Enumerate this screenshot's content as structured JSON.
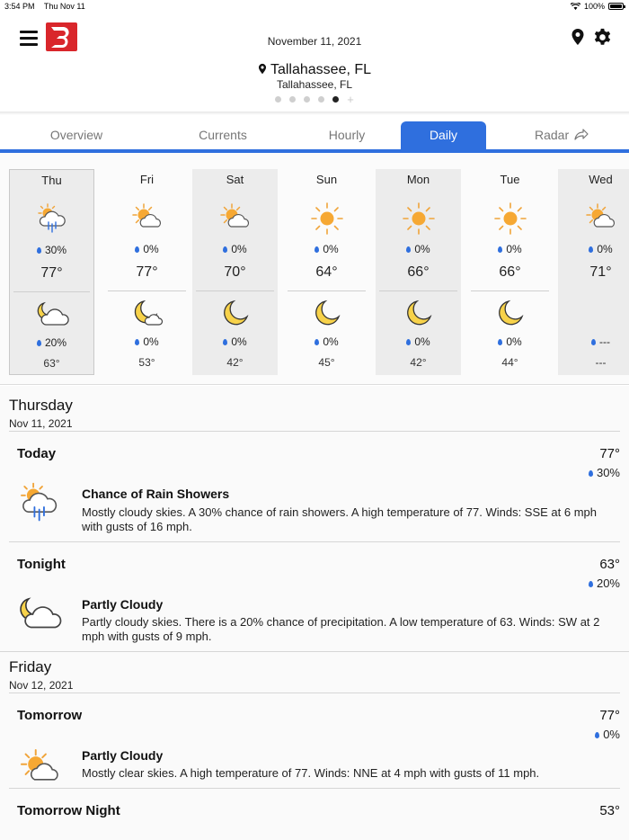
{
  "status_bar": {
    "time": "3:54 PM",
    "date": "Thu Nov 11",
    "battery": "100%",
    "battery_level": 1.0
  },
  "header": {
    "date": "November 11, 2021",
    "location_title": "Tallahassee, FL",
    "location_subtitle": "Tallahassee, FL",
    "page_dots": 5,
    "active_dot": 4,
    "logo_color": "#d9262b"
  },
  "tabs": [
    {
      "label": "Overview",
      "active": false
    },
    {
      "label": "Currents",
      "active": false
    },
    {
      "label": "Hourly",
      "active": false
    },
    {
      "label": "Daily",
      "active": true
    },
    {
      "label": "Radar",
      "active": false
    }
  ],
  "accent_color": "#2f6fde",
  "forecast": [
    {
      "day": "Thu",
      "day_icon": "partly-cloudy-rain-icon",
      "day_precip": "30%",
      "high": "77°",
      "night_icon": "partly-cloudy-night-icon",
      "night_precip": "20%",
      "low": "63°"
    },
    {
      "day": "Fri",
      "day_icon": "partly-sunny-icon",
      "day_precip": "0%",
      "high": "77°",
      "night_icon": "moon-cloud-icon",
      "night_precip": "0%",
      "low": "53°"
    },
    {
      "day": "Sat",
      "day_icon": "partly-sunny-icon",
      "day_precip": "0%",
      "high": "70°",
      "night_icon": "moon-icon",
      "night_precip": "0%",
      "low": "42°"
    },
    {
      "day": "Sun",
      "day_icon": "sun-icon",
      "day_precip": "0%",
      "high": "64°",
      "night_icon": "moon-icon",
      "night_precip": "0%",
      "low": "45°"
    },
    {
      "day": "Mon",
      "day_icon": "sun-icon",
      "day_precip": "0%",
      "high": "66°",
      "night_icon": "moon-icon",
      "night_precip": "0%",
      "low": "42°"
    },
    {
      "day": "Tue",
      "day_icon": "sun-icon",
      "day_precip": "0%",
      "high": "66°",
      "night_icon": "moon-icon",
      "night_precip": "0%",
      "low": "44°"
    },
    {
      "day": "Wed",
      "day_icon": "partly-sunny-icon",
      "day_precip": "0%",
      "high": "71°",
      "night_icon": "",
      "night_precip": "---",
      "low": "---"
    }
  ],
  "details": [
    {
      "title": "Thursday",
      "date": "Nov 11, 2021",
      "periods": [
        {
          "name": "Today",
          "temp": "77°",
          "pop": "30%",
          "icon": "partly-cloudy-rain-icon",
          "condition": "Chance of Rain Showers",
          "text": "Mostly cloudy skies.  A 30% chance of rain showers.  A high temperature of 77.  Winds: SSE at 6 mph with gusts of 16 mph."
        },
        {
          "name": "Tonight",
          "temp": "63°",
          "pop": "20%",
          "icon": "partly-cloudy-night-icon",
          "condition": "Partly Cloudy",
          "text": "Partly cloudy skies. There is a 20% chance of precipitation.  A low temperature of 63.  Winds: SW at 2 mph with gusts of 9 mph."
        }
      ]
    },
    {
      "title": "Friday",
      "date": "Nov 12, 2021",
      "periods": [
        {
          "name": "Tomorrow",
          "temp": "77°",
          "pop": "0%",
          "icon": "partly-sunny-icon",
          "condition": "Partly Cloudy",
          "text": "Mostly clear skies.  A high temperature of 77.  Winds: NNE at 4 mph with gusts of 11 mph."
        },
        {
          "name": "Tomorrow Night",
          "temp": "53°"
        }
      ]
    }
  ]
}
